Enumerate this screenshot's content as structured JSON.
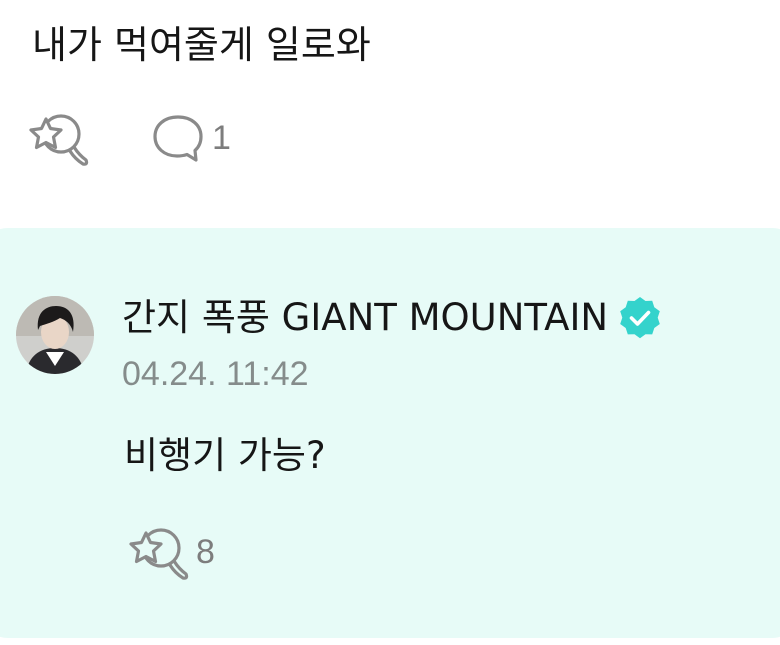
{
  "post": {
    "text": "내가 먹여줄게 일로와",
    "like_icon": "star-badge-icon",
    "comment_icon": "speech-bubble-icon",
    "comment_count": "1"
  },
  "reply": {
    "author_name": "간지 폭풍 GIANT MOUNTAIN",
    "verified_icon": "verified-badge-icon",
    "timestamp": "04.24. 11:42",
    "text": "비행기 가능?",
    "like_icon": "star-badge-icon",
    "like_count": "8"
  },
  "colors": {
    "reply_background": "#e7fbf7",
    "verified_badge": "#34d3cc",
    "icon_stroke": "#8a8a8a",
    "secondary_text": "#858c8b"
  }
}
